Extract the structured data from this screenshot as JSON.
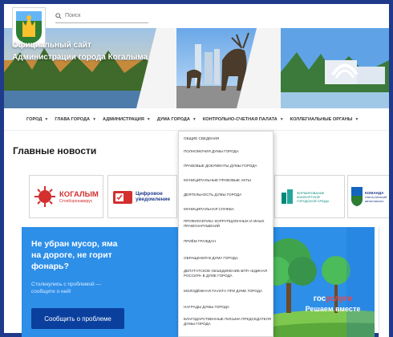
{
  "header": {
    "search_placeholder": "Поиск",
    "site_title_line1": "Официальный сайт",
    "site_title_line2": "Администрации города Когалыма"
  },
  "nav": {
    "items": [
      {
        "label": "ГОРОД"
      },
      {
        "label": "ГЛАВА ГОРОДА"
      },
      {
        "label": "АДМИНИСТРАЦИЯ"
      },
      {
        "label": "ДУМА ГОРОДА"
      },
      {
        "label": "КОНТРОЛЬНО-СЧЕТНАЯ ПАЛАТА"
      },
      {
        "label": "КОЛЛЕГИАЛЬНЫЕ ОРГАНЫ"
      }
    ]
  },
  "dropdown": {
    "items": [
      "ОБЩИЕ СВЕДЕНИЯ",
      "ПОЛНОМОЧИЯ ДУМЫ ГОРОДА",
      "ПРАВОВЫЕ ДОКУМЕНТЫ ДУМЫ ГОРОДА",
      "МУНИЦИПАЛЬНЫЕ ПРАВОВЫЕ АКТЫ",
      "ДЕЯТЕЛЬНОСТЬ ДУМЫ ГОРОДА",
      "МУНИЦИПАЛЬНАЯ СЛУЖБА",
      "ПРОФИЛАКТИКА КОРРУПЦИОННЫХ И ИНЫХ ПРАВОНАРУШЕНИЙ",
      "ПРИЁМ ГРАЖДАН",
      "ОБРАЩЕНИЯ В ДУМУ ГОРОДА",
      "ДЕПУТАТСКОЕ ОБЪЕДИНЕНИЕ ВПП «ЕДИНАЯ РОССИЯ» В ДУМЕ ГОРОДА",
      "МОЛОДЁЖНАЯ ПАЛАТА ПРИ ДУМЕ ГОРОДА",
      "НАГРАДЫ ДУМЫ ГОРОДА",
      "БЛАГОДАРСТВЕННЫЕ ПИСЬМА ПРЕДСЕДАТЕЛЯ ДУМЫ ГОРОДА"
    ]
  },
  "news": {
    "title": "Главные новости"
  },
  "tiles": {
    "kogalym_main": "КОГАЛЫМ",
    "kogalym_sub": "СтопКоронавирус",
    "notice_line1": "Цифровое",
    "notice_line2": "уведомление",
    "env_line1": "ФОРМИРОВАНИЕ",
    "env_line2": "КОМФОРТНОЙ",
    "env_line3": "ГОРОДСКОЙ СРЕДЫ",
    "team_line1": "КОМАНДА",
    "team_line2": "Ханты-Мансий",
    "team_line3": "автономного"
  },
  "banner": {
    "headline_line1": "Не убран мусор, яма",
    "headline_line2": "на дороге, не горит",
    "headline_line3": "фонарь?",
    "sub_line1": "Столкнулись с проблемой —",
    "sub_line2": "сообщите о ней!",
    "button_label": "Сообщить о проблеме",
    "gos_part1": "гос",
    "gos_part2": "услуги",
    "slogan": "Решаем вместе"
  },
  "colors": {
    "frame": "#1f3a8a",
    "banner_blue": "#2d8fe8",
    "button_dark_blue": "#0a3f9e",
    "covid_red": "#d32f2f",
    "gosuslugi_red": "#ef4444"
  }
}
